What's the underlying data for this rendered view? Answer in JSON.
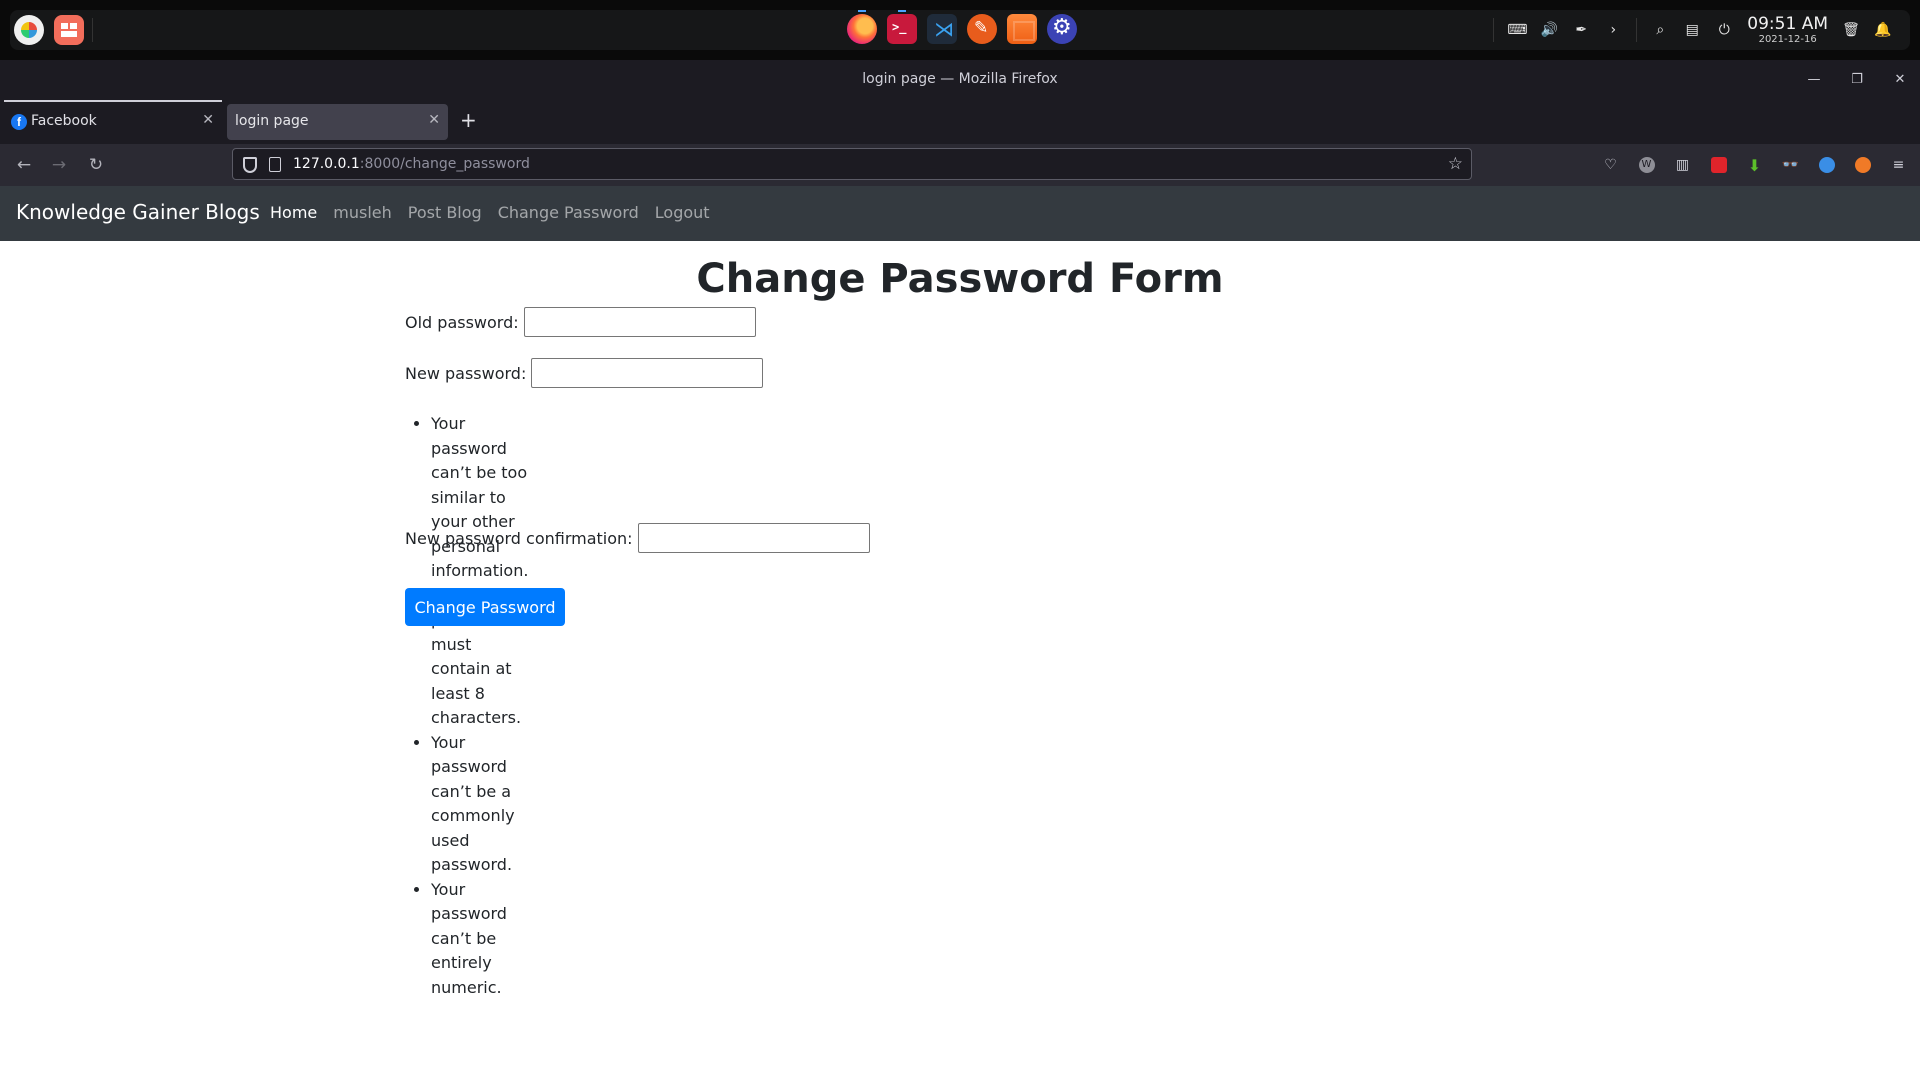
{
  "desktop": {
    "clock_time": "09:51 AM",
    "clock_date": "2021-12-16",
    "dock_apps": [
      "firefox-icon",
      "terminal-icon",
      "vscode-icon",
      "feather-icon",
      "store-icon",
      "settings-icon"
    ]
  },
  "window": {
    "title": "login page — Mozilla Firefox",
    "controls": {
      "minimize": "—",
      "restore": "❐",
      "close": "✕"
    }
  },
  "tabs": [
    {
      "label": "Facebook",
      "favicon": "f",
      "active": false
    },
    {
      "label": "login page",
      "active": true
    }
  ],
  "newtab_label": "+",
  "toolbar": {
    "back": "←",
    "forward": "→",
    "reload": "↻",
    "url_host": "127.0.0.1",
    "url_path": ":8000/change_password",
    "bookmark": "☆",
    "menu": "≡"
  },
  "site": {
    "brand": "Knowledge Gainer Blogs",
    "links": [
      "Home",
      "musleh",
      "Post Blog",
      "Change Password",
      "Logout"
    ],
    "active_link": "Home"
  },
  "form": {
    "title": "Change Password Form",
    "old_password_label": "Old password:",
    "new_password_label": "New password:",
    "confirm_label": "New password confirmation:",
    "help_items": [
      "Your password can’t be too similar to your other personal information.",
      "Your password must contain at least 8 characters.",
      "Your password can’t be a commonly used password.",
      "Your password can’t be entirely numeric."
    ],
    "submit_label": "Change Password",
    "submit_color": "#007bff"
  }
}
